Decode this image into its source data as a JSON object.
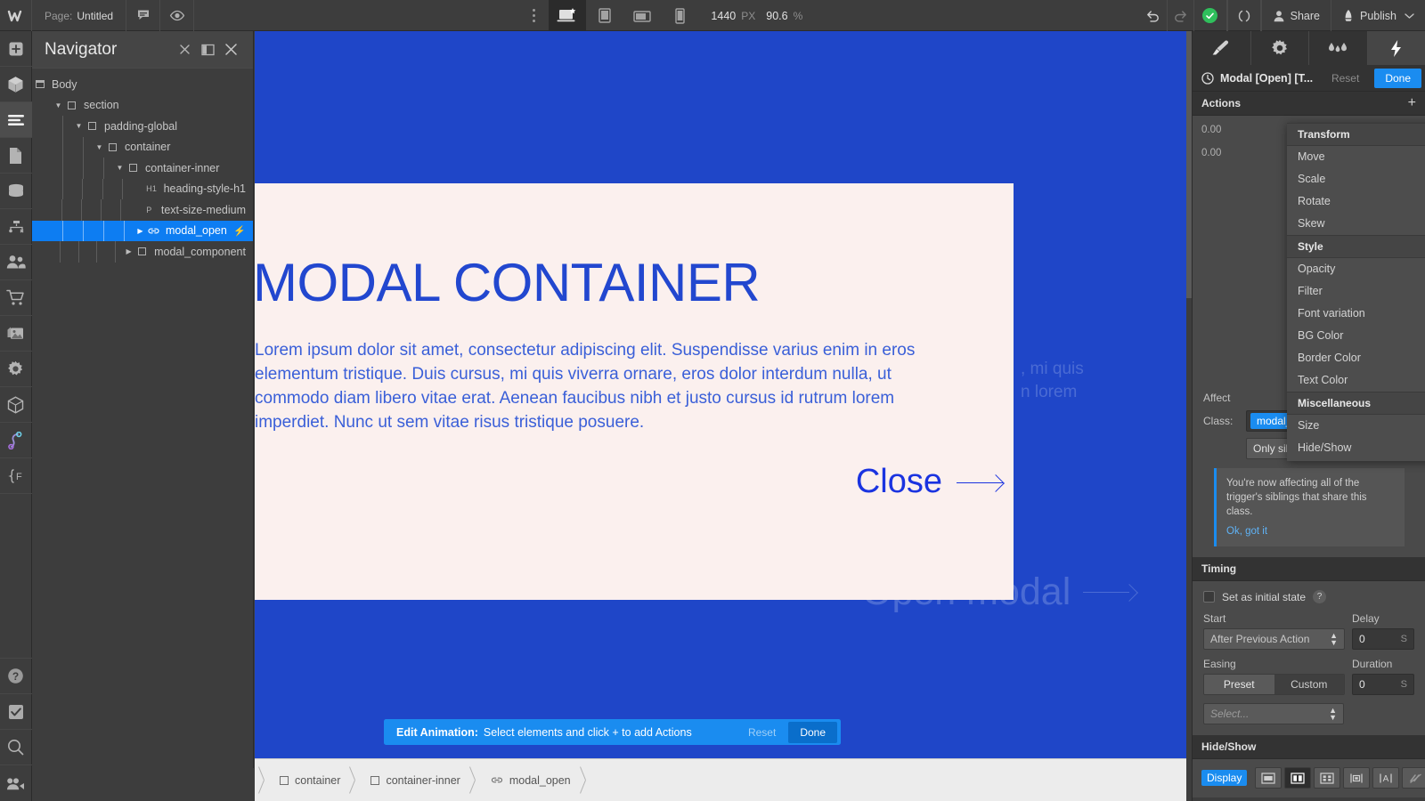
{
  "topbar": {
    "logo": "webflow-logo",
    "page_label": "Page:",
    "page_value": "Untitled",
    "comment_icon": "comment-icon",
    "preview_icon": "eye-icon",
    "more_icon": "more-vertical-icon",
    "breakpoints": [
      {
        "name": "desktop-breakpoint",
        "icon": "desktop-star-icon",
        "active": true
      },
      {
        "name": "tablet-breakpoint",
        "icon": "tablet-icon",
        "active": false
      },
      {
        "name": "mobile-landscape-breakpoint",
        "icon": "mobile-landscape-icon",
        "active": false
      },
      {
        "name": "mobile-portrait-breakpoint",
        "icon": "mobile-portrait-icon",
        "active": false
      }
    ],
    "canvas_width": "1440",
    "canvas_width_unit": "PX",
    "zoom": "90.6",
    "zoom_unit": "%",
    "undo_icon": "undo-icon",
    "redo_icon": "redo-icon",
    "saved_icon": "check-circle-icon",
    "code_icon": "code-brackets-icon",
    "share_label": "Share",
    "publish_label": "Publish"
  },
  "rail": {
    "items": [
      {
        "name": "add-elements",
        "icon": "plus-square-icon",
        "active": false
      },
      {
        "name": "components",
        "icon": "cube-icon",
        "active": false
      },
      {
        "name": "navigator",
        "icon": "layers-lines-icon",
        "active": true
      },
      {
        "name": "pages",
        "icon": "page-icon",
        "active": false
      },
      {
        "name": "cms",
        "icon": "database-icon",
        "active": false
      },
      {
        "name": "logic",
        "icon": "flow-node-icon",
        "active": false
      },
      {
        "name": "users",
        "icon": "people-icon",
        "active": false
      },
      {
        "name": "ecommerce",
        "icon": "cart-icon",
        "active": false
      },
      {
        "name": "assets",
        "icon": "images-icon",
        "active": false
      },
      {
        "name": "settings",
        "icon": "gear-icon",
        "active": false
      },
      {
        "name": "apps",
        "icon": "box-3d-icon",
        "active": false
      },
      {
        "name": "interactions",
        "icon": "interaction-node-icon",
        "active": false
      },
      {
        "name": "custom-code",
        "icon": "curly-f-icon",
        "active": false
      }
    ],
    "bottom_items": [
      {
        "name": "help",
        "icon": "question-circle-icon"
      },
      {
        "name": "audit",
        "icon": "checkbox-check-icon"
      },
      {
        "name": "search",
        "icon": "magnifier-icon"
      },
      {
        "name": "video",
        "icon": "video-camera-icon"
      }
    ]
  },
  "navigator": {
    "title": "Navigator",
    "header_buttons": [
      {
        "name": "collapse-all-button",
        "icon": "x-small-icon"
      },
      {
        "name": "dock-panel-button",
        "icon": "panel-split-icon"
      },
      {
        "name": "close-panel-button",
        "icon": "close-icon"
      }
    ],
    "tree": [
      {
        "label": "Body",
        "depth": 0,
        "icon": "body-icon",
        "caret": "",
        "selected": false,
        "tag": ""
      },
      {
        "label": "section",
        "depth": 1,
        "icon": "block-icon",
        "caret": "down",
        "selected": false,
        "tag": ""
      },
      {
        "label": "padding-global",
        "depth": 2,
        "icon": "block-icon",
        "caret": "down",
        "selected": false,
        "tag": ""
      },
      {
        "label": "container",
        "depth": 3,
        "icon": "block-icon",
        "caret": "down",
        "selected": false,
        "tag": ""
      },
      {
        "label": "container-inner",
        "depth": 4,
        "icon": "block-icon",
        "caret": "down",
        "selected": false,
        "tag": ""
      },
      {
        "label": "heading-style-h1",
        "depth": 5,
        "icon": "tag",
        "caret": "",
        "selected": false,
        "tag": "H1"
      },
      {
        "label": "text-size-medium",
        "depth": 5,
        "icon": "tag",
        "caret": "",
        "selected": false,
        "tag": "P"
      },
      {
        "label": "modal_open",
        "depth": 5,
        "icon": "link-icon",
        "caret": "right",
        "selected": true,
        "tag": "",
        "bolt": true
      },
      {
        "label": "modal_component",
        "depth": 5,
        "icon": "block-icon",
        "caret": "right",
        "selected": false,
        "tag": ""
      }
    ]
  },
  "canvas": {
    "bg_color": "#1f46c8",
    "background_text_line1": ", mi quis",
    "background_text_line2": "n lorem",
    "open_modal_label": "Open modal",
    "open_modal_arrow": "arrow-right-icon",
    "modal": {
      "bg_color": "#fbf0ee",
      "heading": "MODAL CONTAINER",
      "paragraph": "Lorem ipsum dolor sit amet, consectetur adipiscing elit. Suspendisse varius enim in eros elementum tristique. Duis cursus, mi quis viverra ornare, eros dolor interdum nulla, ut commodo diam libero vitae erat. Aenean faucibus nibh et justo cursus id rutrum lorem imperdiet. Nunc ut sem vitae risus tristique posuere.",
      "close_label": "Close",
      "close_arrow": "arrow-right-icon",
      "text_color": "#2247cf"
    },
    "edit_banner": {
      "title": "Edit Animation:",
      "message": "Select elements and click + to add Actions",
      "reset_label": "Reset",
      "done_label": "Done"
    }
  },
  "breadcrumb": {
    "items": [
      {
        "label": "container",
        "icon": "block-icon"
      },
      {
        "label": "container-inner",
        "icon": "block-icon"
      },
      {
        "label": "modal_open",
        "icon": "link-icon"
      }
    ]
  },
  "right_panel": {
    "tabs": [
      {
        "name": "style-tab",
        "icon": "paintbrush-icon",
        "active": false
      },
      {
        "name": "settings-tab",
        "icon": "gear-icon",
        "active": false
      },
      {
        "name": "style-manager-tab",
        "icon": "droplets-icon",
        "active": false
      },
      {
        "name": "interactions-tab",
        "icon": "lightning-bolt-icon",
        "active": true
      }
    ],
    "animation": {
      "clock_icon": "clock-icon",
      "title": "Modal [Open] [T...",
      "reset_label": "Reset",
      "done_label": "Done"
    },
    "actions": {
      "title": "Actions",
      "add_icon": "plus-icon",
      "timeline_values": [
        "0.00",
        "0.00"
      ]
    },
    "dropdown": {
      "groups": [
        {
          "title": "Transform",
          "items": [
            "Move",
            "Scale",
            "Rotate",
            "Skew"
          ]
        },
        {
          "title": "Style",
          "items": [
            "Opacity",
            "Filter",
            "Font variation",
            "BG Color",
            "Border Color",
            "Text Color"
          ]
        },
        {
          "title": "Miscellaneous",
          "items": [
            "Size",
            "Hide/Show"
          ]
        }
      ]
    },
    "affect": {
      "affect_label": "Affect",
      "class_label": "Class:",
      "class_chip": "modal_component",
      "siblings_select": "Only siblings with this class",
      "notice_text": "You're now affecting all of the trigger's siblings that share this class.",
      "notice_link": "Ok, got it"
    },
    "timing": {
      "title": "Timing",
      "initial_state_label": "Set as initial state",
      "help_icon": "question-icon",
      "start_label": "Start",
      "start_value": "After Previous Action",
      "delay_label": "Delay",
      "delay_value": "0",
      "delay_unit": "S",
      "easing_label": "Easing",
      "easing_preset": "Preset",
      "easing_custom": "Custom",
      "easing_select": "Select...",
      "duration_label": "Duration",
      "duration_value": "0",
      "duration_unit": "S"
    },
    "hide_show": {
      "title": "Hide/Show",
      "display_label": "Display",
      "options": [
        {
          "name": "display-block-button",
          "icon": "display-block-icon",
          "active": false
        },
        {
          "name": "display-flex-button",
          "icon": "display-flex-icon",
          "active": true
        },
        {
          "name": "display-grid-button",
          "icon": "display-grid-icon",
          "active": false
        },
        {
          "name": "display-inline-block-button",
          "icon": "display-inline-block-icon",
          "active": false
        },
        {
          "name": "display-inline-button",
          "icon": "display-inline-icon",
          "active": false
        },
        {
          "name": "display-none-button",
          "icon": "display-none-icon",
          "active": false
        }
      ]
    }
  }
}
